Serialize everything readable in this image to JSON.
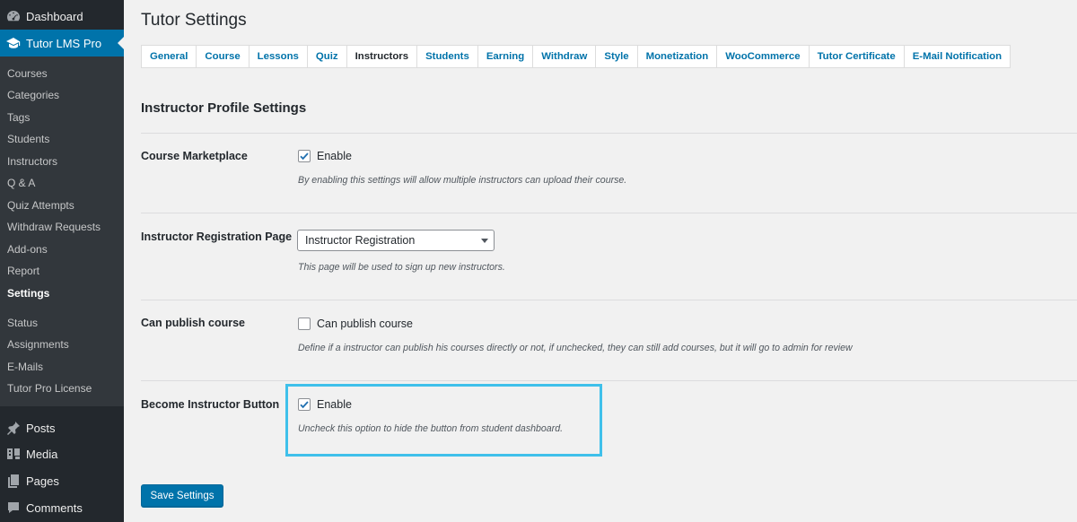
{
  "sidebar": {
    "top_items": [
      {
        "label": "Dashboard",
        "icon": "dashboard-icon"
      },
      {
        "label": "Tutor LMS Pro",
        "icon": "graduation-cap-icon"
      }
    ],
    "submenu": [
      "Courses",
      "Categories",
      "Tags",
      "Students",
      "Instructors",
      "Q & A",
      "Quiz Attempts",
      "Withdraw Requests",
      "Add-ons",
      "Report",
      "Settings",
      "Status",
      "Assignments",
      "E-Mails",
      "Tutor Pro License"
    ],
    "bottom_items": [
      {
        "label": "Posts",
        "icon": "pin-icon"
      },
      {
        "label": "Media",
        "icon": "media-icon"
      },
      {
        "label": "Pages",
        "icon": "pages-icon"
      },
      {
        "label": "Comments",
        "icon": "comments-icon"
      }
    ]
  },
  "page": {
    "title": "Tutor Settings",
    "tabs": [
      "General",
      "Course",
      "Lessons",
      "Quiz",
      "Instructors",
      "Students",
      "Earning",
      "Withdraw",
      "Style",
      "Monetization",
      "WooCommerce",
      "Tutor Certificate",
      "E-Mail Notification"
    ],
    "active_tab": "Instructors",
    "section_title": "Instructor Profile Settings"
  },
  "settings": {
    "marketplace": {
      "label": "Course Marketplace",
      "checkbox_label": "Enable",
      "checked": true,
      "description": "By enabling this settings will allow multiple instructors can upload their course."
    },
    "registration": {
      "label": "Instructor Registration Page",
      "selected": "Instructor Registration",
      "description": "This page will be used to sign up new instructors."
    },
    "publish": {
      "label": "Can publish course",
      "checkbox_label": "Can publish course",
      "checked": false,
      "description": "Define if a instructor can publish his courses directly or not, if unchecked, they can still add courses, but it will go to admin for review"
    },
    "become_instructor": {
      "label": "Become Instructor Button",
      "checkbox_label": "Enable",
      "checked": true,
      "description": "Uncheck this option to hide the button from student dashboard."
    }
  },
  "save_label": "Save Settings",
  "colors": {
    "sidebar_bg": "#23282d",
    "submenu_bg": "#32373c",
    "accent": "#0073aa",
    "highlight": "#3fc0ea",
    "page_bg": "#f1f1f1"
  }
}
